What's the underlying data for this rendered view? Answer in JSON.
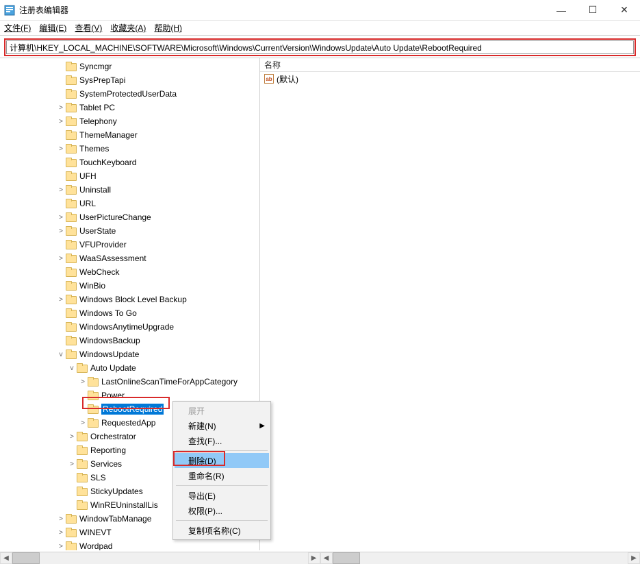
{
  "window": {
    "title": "注册表编辑器"
  },
  "menu": {
    "file": "文件(F)",
    "edit": "编辑(E)",
    "view": "查看(V)",
    "favorites": "收藏夹(A)",
    "help": "帮助(H)"
  },
  "address": "计算机\\HKEY_LOCAL_MACHINE\\SOFTWARE\\Microsoft\\Windows\\CurrentVersion\\WindowsUpdate\\Auto Update\\RebootRequired",
  "values": {
    "header_name": "名称",
    "default_value": "(默认)"
  },
  "contextmenu": {
    "expand": "展开",
    "new": "新建(N)",
    "find": "查找(F)...",
    "delete": "删除(D)",
    "rename": "重命名(R)",
    "export": "导出(E)",
    "permissions": "权限(P)...",
    "copykey": "复制项名称(C)"
  },
  "tree": {
    "indent0": 82,
    "indent1": 98,
    "indent2": 114,
    "indent3": 130,
    "items_lvl0": [
      "Syncmgr",
      "SysPrepTapi",
      "SystemProtectedUserData",
      "Tablet PC",
      "Telephony",
      "ThemeManager",
      "Themes",
      "TouchKeyboard",
      "UFH",
      "Uninstall",
      "URL",
      "UserPictureChange",
      "UserState",
      "VFUProvider",
      "WaaSAssessment",
      "WebCheck",
      "WinBio",
      "Windows Block Level Backup",
      "Windows To Go",
      "WindowsAnytimeUpgrade",
      "WindowsBackup"
    ],
    "windows_update": "WindowsUpdate",
    "auto_update": "Auto Update",
    "au_children": [
      "LastOnlineScanTimeForAppCategory",
      "Power",
      "RebootRequired",
      "RequestedApp"
    ],
    "wu_siblings": [
      "Orchestrator",
      "Reporting",
      "Services",
      "SLS",
      "StickyUpdates",
      "WinREUninstallLis"
    ],
    "after_wu": [
      "WindowTabManage",
      "WINEVT",
      "Wordpad"
    ],
    "expanders_lvl0": [
      "",
      "",
      "",
      ">",
      ">",
      "",
      ">",
      "",
      "",
      ">",
      "",
      ">",
      ">",
      "",
      ">",
      "",
      "",
      ">",
      "",
      "",
      ""
    ],
    "au_child_expanders": [
      ">",
      "",
      "",
      ">"
    ],
    "wu_sib_expanders": [
      ">",
      "",
      ">",
      "",
      "",
      ""
    ],
    "after_wu_expanders": [
      ">",
      ">",
      ">"
    ]
  }
}
